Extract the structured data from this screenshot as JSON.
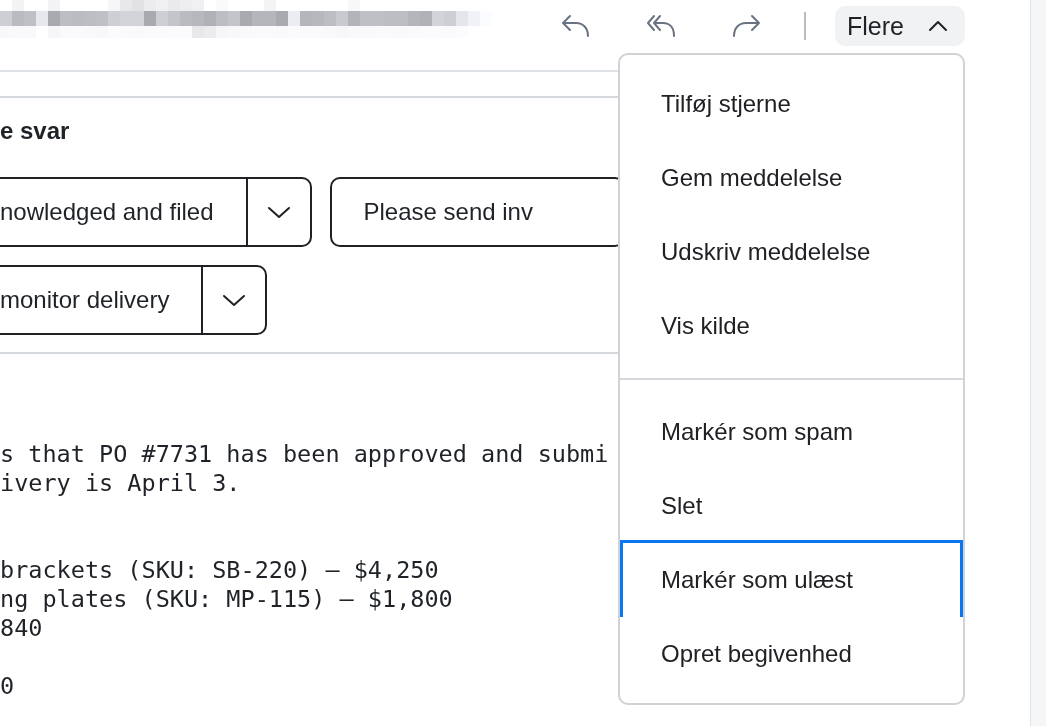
{
  "more_button": {
    "label": "Flere",
    "expanded": true
  },
  "quick_replies": {
    "title": "e svar",
    "rows": [
      {
        "buttons": [
          {
            "label": "nowledged and filed",
            "kind": "split"
          },
          {
            "label": "Please send inv",
            "kind": "plain"
          }
        ]
      },
      {
        "buttons": [
          {
            "label": "monitor delivery",
            "kind": "split"
          }
        ]
      }
    ]
  },
  "message": {
    "paragraphs": [
      {
        "lines": [
          "s that PO #7731 has been approved and submi",
          "ivery is April 3."
        ]
      },
      {
        "lines": [
          "brackets (SKU: SB-220) — $4,250",
          "ng plates (SKU: MP-115) — $1,800",
          "840"
        ]
      },
      {
        "lines": [
          "0"
        ]
      }
    ]
  },
  "menu": {
    "groups": [
      {
        "items": [
          {
            "label": "Tilføj stjerne",
            "focused": false
          },
          {
            "label": "Gem meddelelse",
            "focused": false
          },
          {
            "label": "Udskriv meddelelse",
            "focused": false
          },
          {
            "label": "Vis kilde",
            "focused": false
          }
        ]
      },
      {
        "items": [
          {
            "label": "Markér som spam",
            "focused": false
          },
          {
            "label": "Slet",
            "focused": false
          },
          {
            "label": "Markér som ulæst",
            "focused": true
          },
          {
            "label": "Opret begivenhed",
            "focused": false
          }
        ]
      }
    ]
  }
}
